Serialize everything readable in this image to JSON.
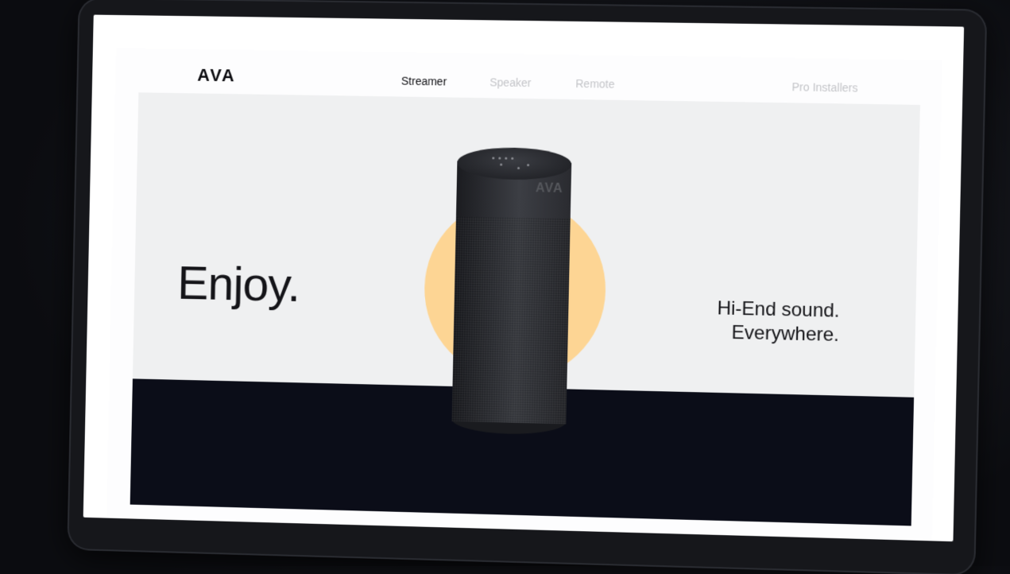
{
  "brand": {
    "logo_text": "AVA"
  },
  "nav": {
    "items": [
      {
        "label": "Streamer",
        "active": true
      },
      {
        "label": "Speaker",
        "active": false
      },
      {
        "label": "Remote",
        "active": false
      },
      {
        "label": "Pro Installers",
        "active": false
      }
    ]
  },
  "hero": {
    "headline": "Enjoy.",
    "tagline_line1": "Hi-End sound.",
    "tagline_line2": "Everywhere.",
    "product_logo": "AVA",
    "accent_color": "#fdd594",
    "hero_bg": "#eff0f1",
    "band_color": "#0b0d18"
  }
}
